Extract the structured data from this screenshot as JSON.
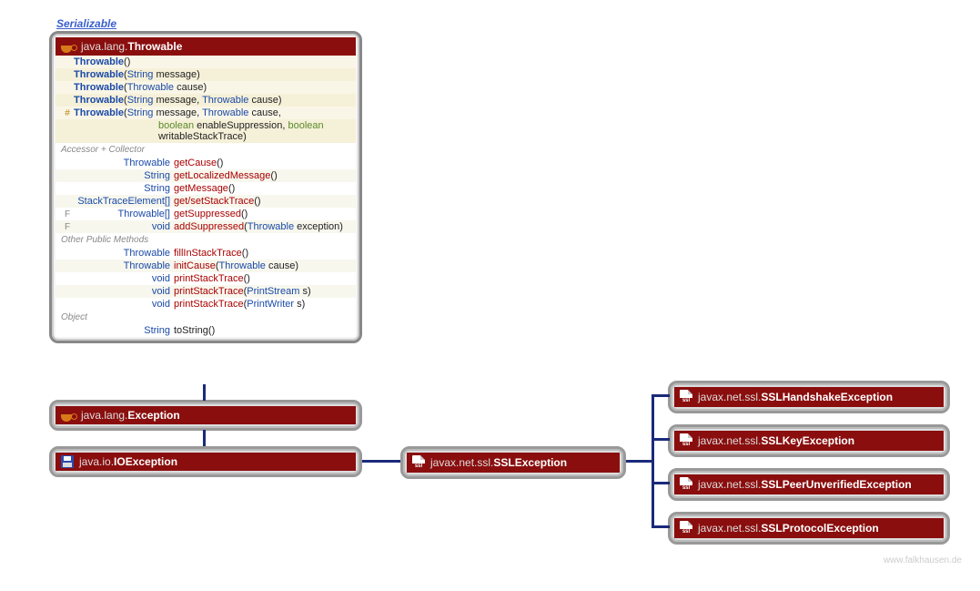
{
  "interface_label": "Serializable",
  "throwable": {
    "pkg": "java.lang.",
    "cls": "Throwable",
    "ctors": [
      {
        "mod": "",
        "name": "Throwable",
        "params": "()"
      },
      {
        "mod": "",
        "name": "Throwable",
        "params_html": "(String message)"
      },
      {
        "mod": "",
        "name": "Throwable",
        "params_html": "(Throwable cause)"
      },
      {
        "mod": "",
        "name": "Throwable",
        "params_html": "(String message, Throwable cause)"
      },
      {
        "mod": "#",
        "name": "Throwable",
        "params_html": "(String message, Throwable cause,"
      },
      {
        "mod": "",
        "name": "",
        "params_html": "boolean enableSuppression, boolean writableStackTrace)"
      }
    ],
    "sections": [
      {
        "label": "Accessor + Collector",
        "rows": [
          {
            "mod": "",
            "ret": "Throwable",
            "method": "getCause",
            "params": "()"
          },
          {
            "mod": "",
            "ret": "String",
            "method": "getLocalizedMessage",
            "params": "()"
          },
          {
            "mod": "",
            "ret": "String",
            "method": "getMessage",
            "params": "()"
          },
          {
            "mod": "",
            "ret": "StackTraceElement[]",
            "method": "get/setStackTrace",
            "params": "()"
          },
          {
            "mod": "F",
            "ret": "Throwable[]",
            "method": "getSuppressed",
            "params": "()"
          },
          {
            "mod": "F",
            "ret": "void",
            "method": "addSuppressed",
            "params_html": "(Throwable exception)"
          }
        ]
      },
      {
        "label": "Other Public Methods",
        "rows": [
          {
            "mod": "",
            "ret": "Throwable",
            "method": "fillInStackTrace",
            "params": "()"
          },
          {
            "mod": "",
            "ret": "Throwable",
            "method": "initCause",
            "params_html": "(Throwable cause)"
          },
          {
            "mod": "",
            "ret": "void",
            "method": "printStackTrace",
            "params": "()"
          },
          {
            "mod": "",
            "ret": "void",
            "method": "printStackTrace",
            "params_html": "(PrintStream s)"
          },
          {
            "mod": "",
            "ret": "void",
            "method": "printStackTrace",
            "params_html": "(PrintWriter s)"
          }
        ]
      },
      {
        "label": "Object",
        "rows": [
          {
            "mod": "",
            "ret": "String",
            "method_plain": "toString",
            "params": "()"
          }
        ]
      }
    ]
  },
  "exception": {
    "pkg": "java.lang.",
    "cls": "Exception"
  },
  "ioexception": {
    "pkg": "java.io.",
    "cls": "IOException"
  },
  "sslexception": {
    "pkg": "javax.net.ssl.",
    "cls": "SSLException"
  },
  "subs": [
    {
      "pkg": "javax.net.ssl.",
      "cls": "SSLHandshakeException"
    },
    {
      "pkg": "javax.net.ssl.",
      "cls": "SSLKeyException"
    },
    {
      "pkg": "javax.net.ssl.",
      "cls": "SSLPeerUnverifiedException"
    },
    {
      "pkg": "javax.net.ssl.",
      "cls": "SSLProtocolException"
    }
  ],
  "watermark": "www.falkhausen.de"
}
